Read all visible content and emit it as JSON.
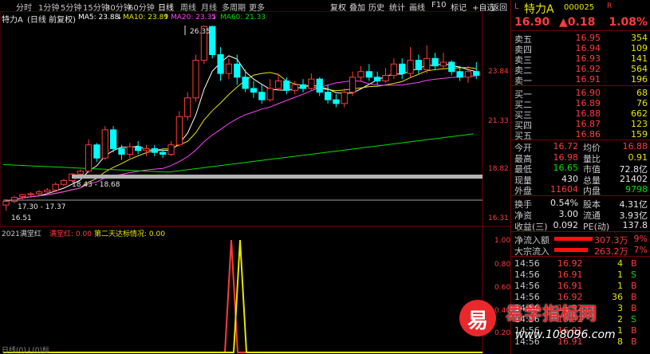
{
  "toolbar": {
    "name": "特力A",
    "period_label": "(日线 前复权)",
    "tabs": [
      "分时",
      "1分钟",
      "5分钟",
      "15分钟",
      "30分钟",
      "60分钟",
      "日线",
      "周线",
      "月线",
      "多周期",
      "更多"
    ],
    "active_tab": "日线",
    "buttons": [
      "复权",
      "叠加",
      "历史",
      "统计",
      "画线",
      "F10",
      "标记",
      "+自选",
      "返回"
    ]
  },
  "ma": {
    "ma5": "MA5: 23.88",
    "ma10": "MA10: 23.89",
    "ma20": "MA20: 23.35",
    "ma60": "MA60: 21.33",
    "arrow_up": "↑",
    "arrow_down": "↓",
    "colors": {
      "ma5": "#ffffff",
      "ma10": "#e6e600",
      "ma20": "#ff40ff",
      "ma60": "#00e000"
    }
  },
  "price_axis": [
    "23.84",
    "21.33",
    "18.82",
    "16.31"
  ],
  "annotations": {
    "high": "26.35",
    "low": "16.51",
    "range1": "18.43 - 18.68",
    "range2": "17.30 - 17.37"
  },
  "indicator": {
    "title": "2021满堂红",
    "series1_label": "满堂红: 0.00",
    "series2_label": "第二天达标情况: 0.00",
    "axis": [
      "1.00",
      "0.80",
      "0.60",
      "0.40",
      "0.20"
    ],
    "bottom_label": "日线(0)↓(0)标"
  },
  "quote": {
    "marker": "L",
    "name": "特力A",
    "code": "000025",
    "marker2": "R",
    "price": "16.90",
    "change": "▲0.18",
    "pct": "1.08%"
  },
  "asks": [
    {
      "label": "卖五",
      "price": "16.95",
      "vol": "354"
    },
    {
      "label": "卖四",
      "price": "16.94",
      "vol": "109"
    },
    {
      "label": "卖三",
      "price": "16.93",
      "vol": "141"
    },
    {
      "label": "卖二",
      "price": "16.92",
      "vol": "564"
    },
    {
      "label": "卖一",
      "price": "16.91",
      "vol": "196"
    }
  ],
  "bids": [
    {
      "label": "买一",
      "price": "16.90",
      "vol": "68"
    },
    {
      "label": "买二",
      "price": "16.89",
      "vol": "76"
    },
    {
      "label": "买三",
      "price": "16.88",
      "vol": "662"
    },
    {
      "label": "买四",
      "price": "16.87",
      "vol": "123"
    },
    {
      "label": "买五",
      "price": "16.86",
      "vol": "159"
    }
  ],
  "stats": [
    {
      "l1": "今开",
      "v1": "16.72",
      "c1": "red",
      "l2": "均价",
      "v2": "16.88",
      "c2": "red"
    },
    {
      "l1": "最高",
      "v1": "16.98",
      "c1": "red",
      "l2": "量比",
      "v2": "0.91",
      "c2": "yellow"
    },
    {
      "l1": "最低",
      "v1": "16.65",
      "c1": "green",
      "l2": "市值",
      "v2": "72.8亿",
      "c2": "white"
    },
    {
      "l1": "现量",
      "v1": "430",
      "c1": "white",
      "l2": "总量",
      "v2": "21402",
      "c2": "white"
    },
    {
      "l1": "外盘",
      "v1": "11604",
      "c1": "red",
      "l2": "内盘",
      "v2": "9798",
      "c2": "green"
    }
  ],
  "stats2": [
    {
      "l1": "换手",
      "v1": "0.54%",
      "c1": "white",
      "l2": "股本",
      "v2": "4.31亿",
      "c2": "white"
    },
    {
      "l1": "净资",
      "v1": "3.00",
      "c1": "white",
      "l2": "流通",
      "v2": "3.93亿",
      "c2": "white"
    },
    {
      "l1": "收益(三)",
      "v1": "0.092",
      "c1": "white",
      "l2": "PE(动)",
      "v2": "137.8",
      "c2": "white"
    }
  ],
  "flows": [
    {
      "label": "净流入额",
      "value": "307.3万",
      "pct": "9%"
    },
    {
      "label": "大宗流入",
      "value": "263.2万",
      "pct": "7%"
    }
  ],
  "ticks": [
    {
      "t": "14:56",
      "p": "16.92",
      "v": "4",
      "d": "B"
    },
    {
      "t": "14:56",
      "p": "16.91",
      "v": "1",
      "d": "S"
    },
    {
      "t": "14:56",
      "p": "16.91",
      "v": "1",
      "d": "B"
    },
    {
      "t": "14:56",
      "p": "16.92",
      "v": "36",
      "d": "B"
    },
    {
      "t": "14:56",
      "p": "16.92",
      "v": "3",
      "d": "B"
    },
    {
      "t": "14:56",
      "p": "16.92",
      "v": "2",
      "d": "S"
    },
    {
      "t": "14:56",
      "p": "16.91",
      "v": "1",
      "d": "B"
    },
    {
      "t": "14:56",
      "p": "16.91",
      "v": "8",
      "d": "B"
    }
  ],
  "watermark": {
    "text": "易学指标网",
    "url": "www.108096.com",
    "logo_char": "易"
  }
}
